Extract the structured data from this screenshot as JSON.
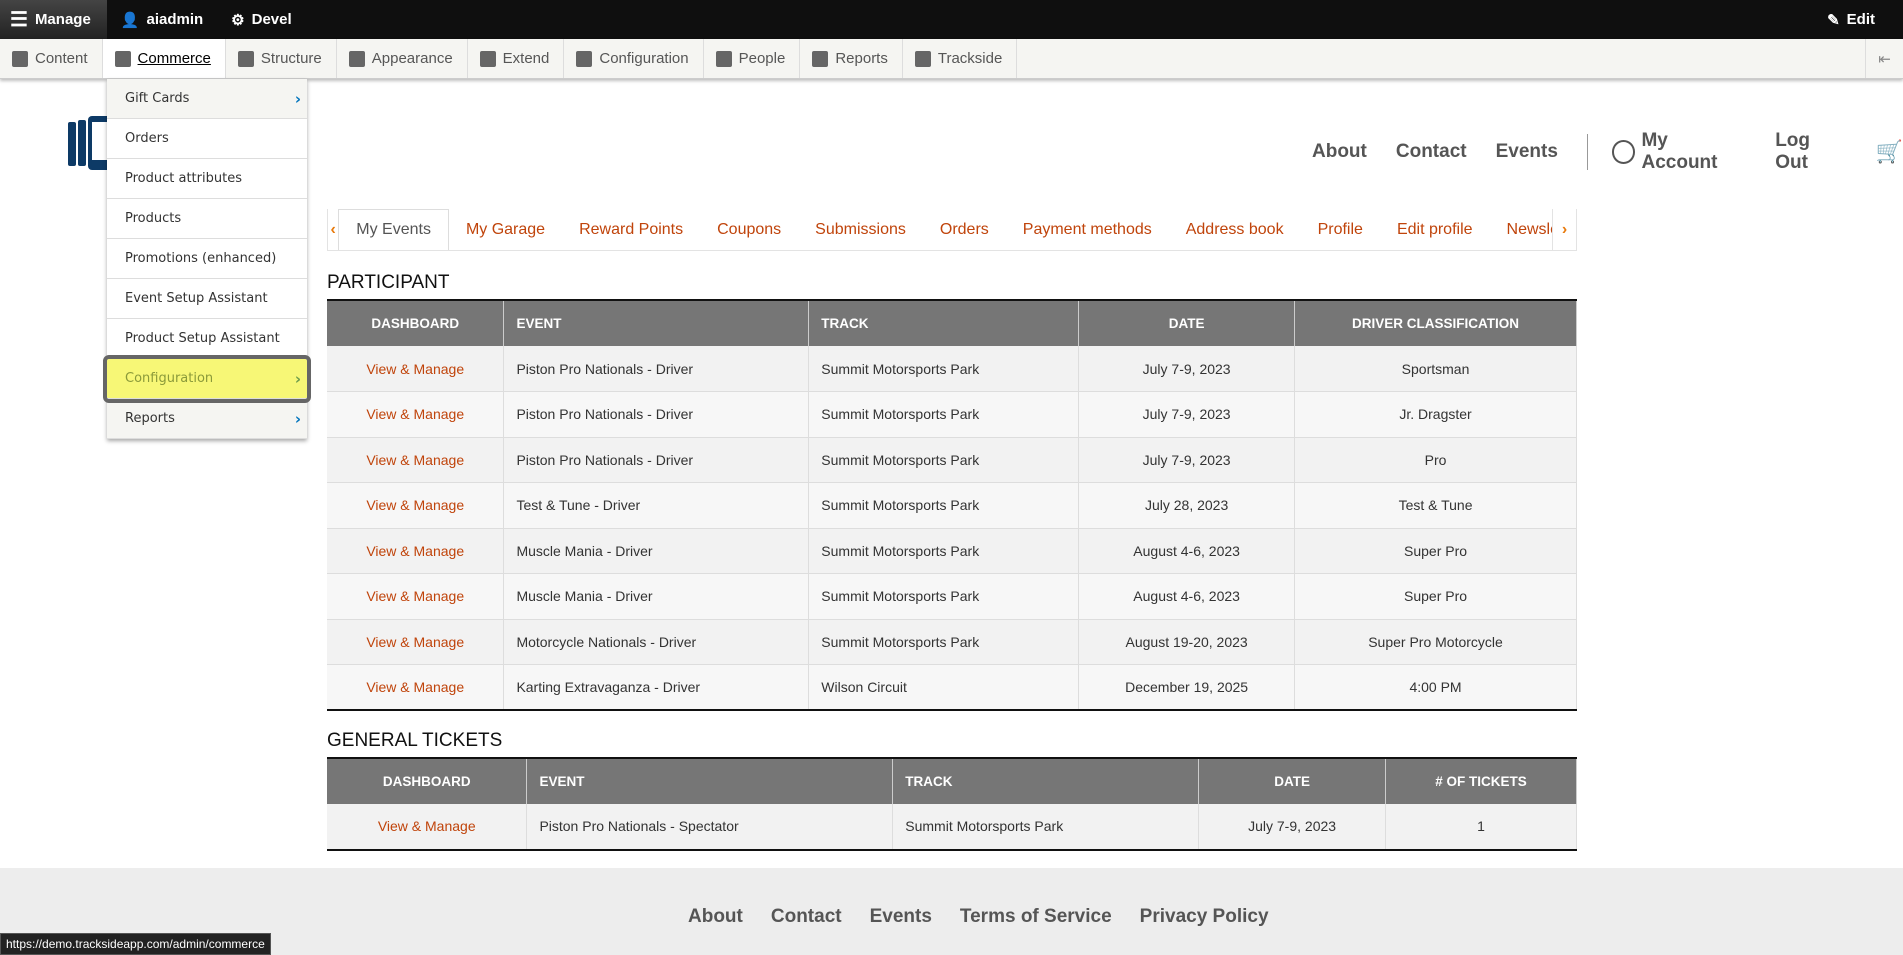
{
  "admin_bar": {
    "manage": "Manage",
    "user": "aiadmin",
    "devel": "Devel",
    "edit": "Edit"
  },
  "toolbar": [
    {
      "label": "Content",
      "icon": "file-icon"
    },
    {
      "label": "Commerce",
      "icon": "cart-icon",
      "active": true
    },
    {
      "label": "Structure",
      "icon": "sitemap-icon"
    },
    {
      "label": "Appearance",
      "icon": "brush-icon"
    },
    {
      "label": "Extend",
      "icon": "puzzle-icon"
    },
    {
      "label": "Configuration",
      "icon": "wrench-icon"
    },
    {
      "label": "People",
      "icon": "people-icon"
    },
    {
      "label": "Reports",
      "icon": "bar-chart-icon"
    },
    {
      "label": "Trackside",
      "icon": "checkered-flag-icon"
    }
  ],
  "dropdown": [
    "Gift Cards",
    "Orders",
    "Product attributes",
    "Products",
    "Promotions (enhanced)",
    "Event Setup Assistant",
    "Product Setup Assistant",
    "Configuration",
    "Reports"
  ],
  "main_nav": {
    "about": "About",
    "contact": "Contact",
    "events": "Events",
    "account": "My Account",
    "logout": "Log Out"
  },
  "tabs": [
    "My Events",
    "My Garage",
    "Reward Points",
    "Coupons",
    "Submissions",
    "Orders",
    "Payment methods",
    "Address book",
    "Profile",
    "Edit profile",
    "Newsle"
  ],
  "participant": {
    "title": "PARTICIPANT",
    "headers": [
      "DASHBOARD",
      "EVENT",
      "TRACK",
      "DATE",
      "DRIVER CLASSIFICATION"
    ],
    "rows": [
      [
        "View & Manage",
        "Piston Pro Nationals - Driver",
        "Summit Motorsports Park",
        "July 7-9, 2023",
        "Sportsman"
      ],
      [
        "View & Manage",
        "Piston Pro Nationals - Driver",
        "Summit Motorsports Park",
        "July 7-9, 2023",
        "Jr. Dragster"
      ],
      [
        "View & Manage",
        "Piston Pro Nationals - Driver",
        "Summit Motorsports Park",
        "July 7-9, 2023",
        "Pro"
      ],
      [
        "View & Manage",
        "Test & Tune - Driver",
        "Summit Motorsports Park",
        "July 28, 2023",
        "Test & Tune"
      ],
      [
        "View & Manage",
        "Muscle Mania - Driver",
        "Summit Motorsports Park",
        "August 4-6, 2023",
        "Super Pro"
      ],
      [
        "View & Manage",
        "Muscle Mania - Driver",
        "Summit Motorsports Park",
        "August 4-6, 2023",
        "Super Pro"
      ],
      [
        "View & Manage",
        "Motorcycle Nationals - Driver",
        "Summit Motorsports Park",
        "August 19-20, 2023",
        "Super Pro Motorcycle"
      ],
      [
        "View & Manage",
        "Karting Extravaganza - Driver",
        "Wilson Circuit",
        "December 19, 2025",
        "4:00 PM"
      ]
    ]
  },
  "general": {
    "title": "GENERAL TICKETS",
    "headers": [
      "DASHBOARD",
      "EVENT",
      "TRACK",
      "DATE",
      "# OF TICKETS"
    ],
    "rows": [
      [
        "View & Manage",
        "Piston Pro Nationals - Spectator",
        "Summit Motorsports Park",
        "July 7-9, 2023",
        "1"
      ]
    ]
  },
  "footer": [
    "About",
    "Contact",
    "Events",
    "Terms of Service",
    "Privacy Policy"
  ],
  "status_url": "https://demo.tracksideapp.com/admin/commerce"
}
